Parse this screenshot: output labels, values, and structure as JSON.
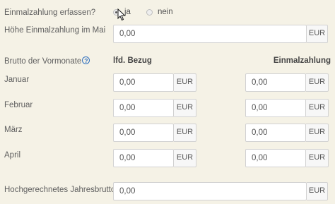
{
  "einmalzahlung": {
    "label": "Einmalzahlung erfassen?",
    "options": [
      {
        "label": "ja",
        "checked": true
      },
      {
        "label": "nein",
        "checked": false
      }
    ]
  },
  "hoehe": {
    "label": "Höhe Einmalzahlung im Mai",
    "value": "0,00",
    "unit": "EUR"
  },
  "vormonate": {
    "label": "Brutto der Vormonate",
    "help_icon": "help-icon",
    "col_lfd": "lfd. Bezug",
    "col_einmal": "Einmalzahlung",
    "months": [
      {
        "label": "Januar",
        "lfd": "0,00",
        "einmal": "0,00"
      },
      {
        "label": "Februar",
        "lfd": "0,00",
        "einmal": "0,00"
      },
      {
        "label": "März",
        "lfd": "0,00",
        "einmal": "0,00"
      },
      {
        "label": "April",
        "lfd": "0,00",
        "einmal": "0,00"
      }
    ],
    "unit": "EUR"
  },
  "jahresbrutto": {
    "label": "Hochgerechnetes Jahresbrutto",
    "help_icon": "help-icon",
    "value": "0,00",
    "unit": "EUR"
  }
}
